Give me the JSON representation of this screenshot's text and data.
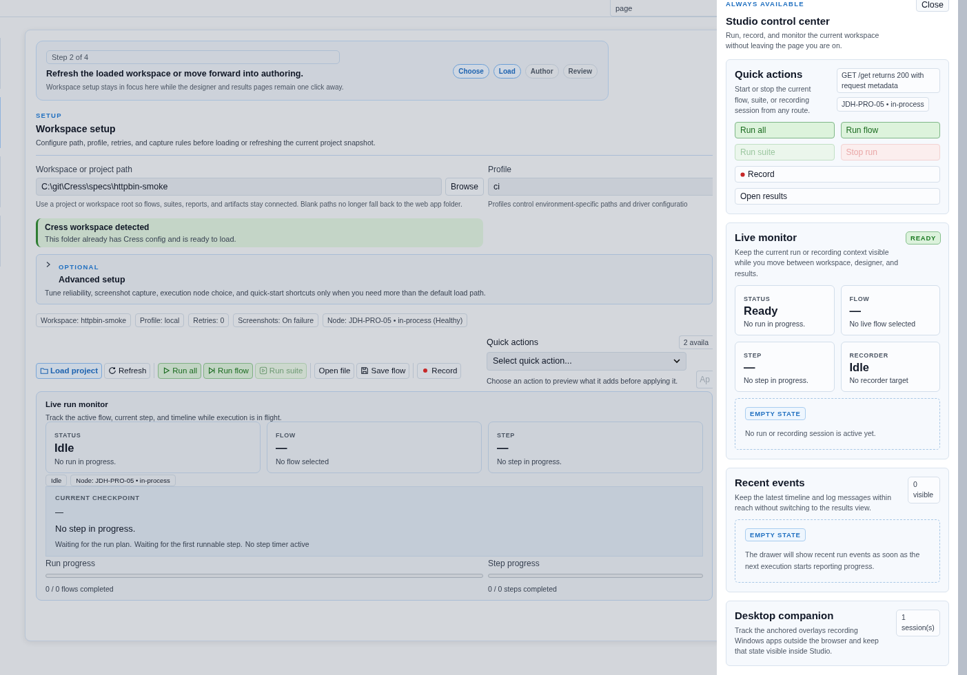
{
  "top_bar": {
    "fragment": "page"
  },
  "stepper": {
    "step": "Step 2 of 4",
    "title": "Refresh the loaded workspace or move forward into authoring.",
    "description": "Workspace setup stays in focus here while the designer and results pages remain one click away.",
    "steps": [
      {
        "label": "Choose",
        "reached": true
      },
      {
        "label": "Load",
        "reached": true
      },
      {
        "label": "Author",
        "reached": false
      },
      {
        "label": "Review",
        "reached": false
      }
    ]
  },
  "setup": {
    "eyebrow": "SETUP",
    "title": "Workspace setup",
    "description": "Configure path, profile, retries, and capture rules before loading or refreshing the current project snapshot."
  },
  "path_field": {
    "label": "Workspace or project path",
    "value": "C:\\git\\Cress\\specs\\httpbin-smoke",
    "button": "Browse",
    "help": "Use a project or workspace root so flows, suites, reports, and artifacts stay connected. Blank paths no longer fall back to the web app folder."
  },
  "profile_field": {
    "label": "Profile",
    "value": "ci",
    "help": "Profiles control environment-specific paths and driver configuratio"
  },
  "alert": {
    "title": "Cress workspace detected",
    "text": "This folder already has Cress config and is ready to load."
  },
  "advanced": {
    "expanded": false,
    "eyebrow": "OPTIONAL",
    "title": "Advanced setup",
    "description": "Tune reliability, screenshot capture, execution node choice, and quick-start shortcuts only when you need more than the default load path."
  },
  "chips": [
    "Workspace: httpbin-smoke",
    "Profile: local",
    "Retries: 0",
    "Screenshots: On failure",
    "Node: JDH-PRO-05 • in-process (Healthy)"
  ],
  "toolbar": [
    [
      {
        "label": "Load project",
        "kind": "primary",
        "disabled": false
      },
      {
        "label": "Refresh",
        "kind": "plain",
        "disabled": false
      }
    ],
    [
      {
        "label": "Run all",
        "kind": "success",
        "disabled": false
      },
      {
        "label": "Run flow",
        "kind": "success",
        "disabled": false
      },
      {
        "label": "Run suite",
        "kind": "success",
        "disabled": true
      }
    ],
    [
      {
        "label": "Open file",
        "kind": "plain",
        "disabled": false
      },
      {
        "label": "Save flow",
        "kind": "plain",
        "disabled": false
      }
    ],
    [
      {
        "label": "Record",
        "kind": "plain",
        "disabled": false
      }
    ]
  ],
  "quick_actions": {
    "label": "Quick actions",
    "count": "2 availa",
    "select": "Select quick action...",
    "help": "Choose an action to preview what it adds before applying it.",
    "apply": "Ap"
  },
  "monitor": {
    "title": "Live run monitor",
    "description": "Track the active flow, current step, and timeline while execution is in flight.",
    "cards": [
      {
        "label": "STATUS",
        "value": "Idle",
        "note": "No run in progress."
      },
      {
        "label": "FLOW",
        "value": "—",
        "note": "No flow selected"
      },
      {
        "label": "STEP",
        "value": "—",
        "note": "No step in progress."
      }
    ],
    "tags": [
      "Idle",
      "Node: JDH-PRO-05 • in-process"
    ],
    "checkpoint": {
      "label": "CURRENT CHECKPOINT",
      "value": "—",
      "title": "No step in progress.",
      "notes": [
        "Waiting for the run plan.",
        "Waiting for the first runnable step.",
        "No step timer active"
      ]
    },
    "progress": [
      {
        "label": "Run progress",
        "level": 0,
        "caption": "0 / 0 flows completed"
      },
      {
        "label": "Step progress",
        "level": 0,
        "caption": "0 / 0 steps completed"
      }
    ]
  },
  "drawer": {
    "eyebrow": "ALWAYS AVAILABLE",
    "title": "Studio control center",
    "description": "Run, record, and monitor the current workspace without leaving the page you are on.",
    "close": "Close",
    "quick": {
      "title": "Quick actions",
      "description": "Start or stop the current flow, suite, or recording session from any route.",
      "badges": [
        "GET /get returns 200 with request metadata",
        "JDH-PRO-05 • in-process"
      ],
      "actions": [
        {
          "label": "Run all",
          "kind": "success",
          "disabled": false,
          "wide": false
        },
        {
          "label": "Run flow",
          "kind": "success",
          "disabled": false,
          "wide": false
        },
        {
          "label": "Run suite",
          "kind": "success",
          "disabled": true,
          "wide": false
        },
        {
          "label": "Stop run",
          "kind": "danger",
          "disabled": true,
          "wide": false
        },
        {
          "label": "Record",
          "kind": "record",
          "disabled": false,
          "wide": true
        },
        {
          "label": "Open results",
          "kind": "plain",
          "disabled": false,
          "wide": true
        }
      ]
    },
    "live": {
      "title": "Live monitor",
      "status": "READY",
      "description": "Keep the current run or recording context visible while you move between workspace, designer, and results.",
      "cards": [
        {
          "label": "STATUS",
          "value": "Ready",
          "note": "No run in progress."
        },
        {
          "label": "FLOW",
          "value": "—",
          "note": "No live flow selected"
        },
        {
          "label": "STEP",
          "value": "—",
          "note": "No step in progress."
        },
        {
          "label": "RECORDER",
          "value": "Idle",
          "note": "No recorder target"
        }
      ],
      "empty": {
        "badge": "EMPTY STATE",
        "text": "No run or recording session is active yet."
      }
    },
    "events": {
      "title": "Recent events",
      "count": "0 visible",
      "description": "Keep the latest timeline and log messages within reach without switching to the results view.",
      "empty": {
        "badge": "EMPTY STATE",
        "text": "The drawer will show recent run events as soon as the next execution starts reporting progress."
      }
    },
    "desktop": {
      "title": "Desktop companion",
      "count": "1 session(s)",
      "description": "Track the anchored overlays recording Windows apps outside the browser and keep that state visible inside Studio."
    }
  }
}
